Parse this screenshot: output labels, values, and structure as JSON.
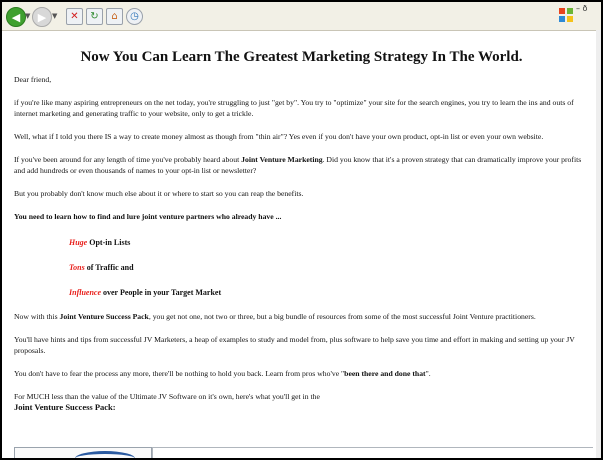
{
  "toolbar": {
    "back_icon": "back-arrow-icon",
    "forward_icon": "forward-arrow-icon",
    "stop_icon": "stop-icon",
    "refresh_icon": "refresh-icon",
    "home_icon": "home-icon",
    "history_icon": "history-icon"
  },
  "page": {
    "headline": "Now You Can Learn The Greatest Marketing Strategy In The World.",
    "greeting": "Dear friend,",
    "para1": "if you're like many aspiring entrepreneurs on the net today, you're struggling to just \"get by\". You try to \"optimize\" your site for the search engines, you try to learn the ins and outs of internet marketing and generating traffic to your website, only to get a trickle.",
    "para2": "Well, what if I told you there IS a way to create money almost as though from \"thin air\"? Yes even if you don't have your own product, opt-in list or even your own website.",
    "para3_pre": "If you've been around for any length of time you've probably heard about ",
    "para3_bold": "Joint Venture Marketing",
    "para3_post": ". Did you know that it's a proven strategy that can dramatically improve your profits and add hundreds or even thousands of names to your opt-in list or newsletter?",
    "para4": "But you probably don't know much else about it or where to start so you can reap the benefits.",
    "para5": "You need to learn how to find and lure joint venture partners who already have ...",
    "list": [
      {
        "red": "Huge",
        "rest": " Opt-in Lists"
      },
      {
        "red": "Tons",
        "rest": " of Traffic and"
      },
      {
        "red": "Influence",
        "rest": " over People in your Target Market"
      }
    ],
    "para6_pre": "Now with this ",
    "para6_bold": "Joint Venture Success Pack",
    "para6_post": ", you get not one, not two or three, but a big bundle of resources from some of the most successful Joint Venture practitioners.",
    "para7": "You'll have hints and tips from successful JV Marketers, a heap of examples to study and model from, plus software to help save you time and effort in making and setting up your JV proposals.",
    "para8_pre": "You don't have to fear the process any more, there'll be nothing to hold you back. Learn from pros who've \"",
    "para8_bold": "been there and done that",
    "para8_post": "\".",
    "para9": "For MUCH less than the value of the Ultimate JV Software on it's own, here's what you'll get in the",
    "para9_title": "Joint Venture Success Pack",
    "para9_end": ":"
  }
}
